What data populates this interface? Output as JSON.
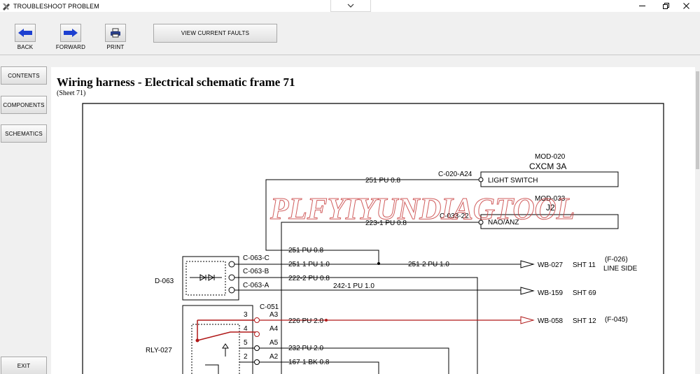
{
  "window": {
    "title": "TROUBLESHOOT PROBLEM"
  },
  "toolbar": {
    "back_label": "BACK",
    "forward_label": "FORWARD",
    "print_label": "PRINT",
    "view_faults_label": "VIEW CURRENT FAULTS"
  },
  "nav": {
    "contents": "CONTENTS",
    "components": "COMPONENTS",
    "schematics": "SCHEMATICS",
    "exit": "EXIT"
  },
  "page": {
    "title": "Wiring harness - Electrical schematic frame 71",
    "subtitle": "(Sheet 71)"
  },
  "schematic": {
    "watermark": "PLFYIYUNDIAGTOOL",
    "mod020_id": "MOD-020",
    "mod020_name": "CXCM  3A",
    "mod020_conn": "C-020-A24",
    "mod020_pin": "LIGHT SWITCH",
    "mod033_id": "MOD-033",
    "mod033_name": "J2",
    "mod033_conn": "C-033-22",
    "mod033_pin": "NAO/ANZ",
    "wire_251_top": "251 PU 0.8",
    "wire_223": "223-1 PU 0.8",
    "wire_251_mid": "251 PU 0.8",
    "wire_251_1": "251-1 PU 1.0",
    "wire_251_2": "251-2 PU 1.0",
    "wire_222": "222-2 PU 0.8",
    "wire_242": "242-1 PU 1.0",
    "wire_226": "226 PU 2.0",
    "wire_232": "232 PU 2.0",
    "wire_167": "167-1 BK 0.8",
    "d063": "D-063",
    "c063c": "C-063-C",
    "c063b": "C-063-B",
    "c063a": "C-063-A",
    "c051": "C-051",
    "rly027": "RLY-027",
    "pin3": "3",
    "pin4": "4",
    "pin5": "5",
    "pin2": "2",
    "a3": "A3",
    "a4": "A4",
    "a5": "A5",
    "a2": "A2",
    "wb027": "WB-027",
    "sht11": "SHT 11",
    "f026": "(F-026)",
    "lineside": "LINE SIDE",
    "wb159": "WB-159",
    "sht69": "SHT 69",
    "wb058": "WB-058",
    "sht12": "SHT 12",
    "f045": "(F-045)"
  },
  "colors": {
    "accent_blue": "#1c3fd0",
    "wire_red": "#b01818",
    "watermark": "#c84040"
  }
}
